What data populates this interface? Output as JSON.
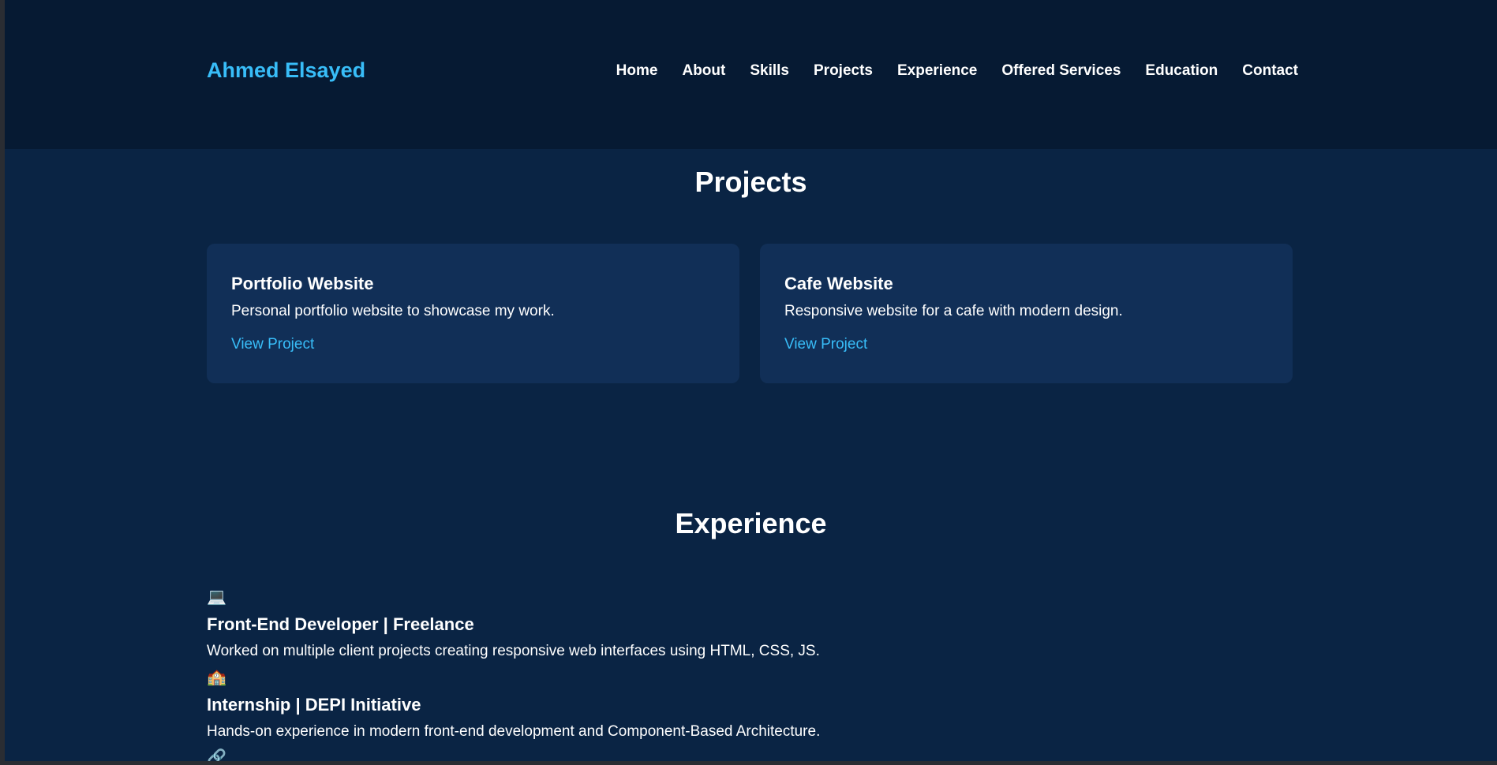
{
  "header": {
    "logo": "Ahmed Elsayed",
    "nav": [
      "Home",
      "About",
      "Skills",
      "Projects",
      "Experience",
      "Offered Services",
      "Education",
      "Contact"
    ]
  },
  "projects": {
    "title": "Projects",
    "items": [
      {
        "title": "Portfolio Website",
        "desc": "Personal portfolio website to showcase my work.",
        "link": "View Project"
      },
      {
        "title": "Cafe Website",
        "desc": "Responsive website for a cafe with modern design.",
        "link": "View Project"
      }
    ]
  },
  "experience": {
    "title": "Experience",
    "items": [
      {
        "icon": "💻",
        "title": "Front-End Developer | Freelance",
        "desc": "Worked on multiple client projects creating responsive web interfaces using HTML, CSS, JS."
      },
      {
        "icon": "🏫",
        "title": "Internship | DEPI Initiative",
        "desc": "Hands-on experience in modern front-end development and Component-Based Architecture."
      },
      {
        "icon": "🔗"
      }
    ]
  },
  "colors": {
    "accent": "#38bdf8",
    "header_bg": "#061a33",
    "page_bg": "#0a2444",
    "card_bg": "#112f57"
  }
}
